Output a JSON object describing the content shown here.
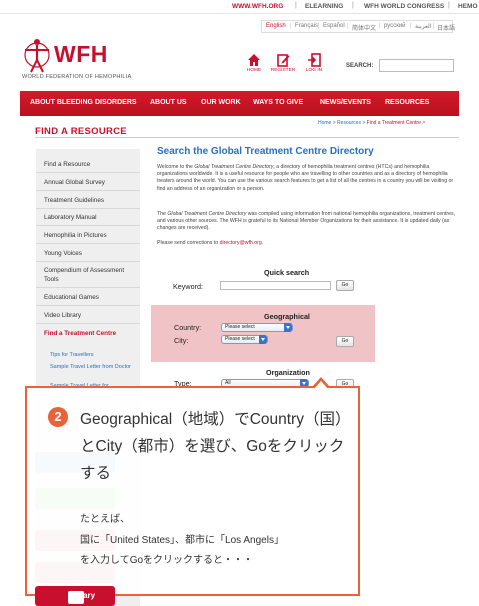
{
  "topbar": {
    "site": "WWW.WFH.ORG",
    "links": [
      "ELEARNING",
      "WFH WORLD CONGRESS",
      "HEMO"
    ],
    "separator": "|"
  },
  "languages": {
    "active": "English",
    "others": [
      "Français",
      "Español",
      "简体中文",
      "русский",
      "العربية",
      "日本語"
    ],
    "separator": "|"
  },
  "logo": {
    "text": "WFH",
    "subtitle": "WORLD FEDERATION OF HEMOPHILIA"
  },
  "header_icons": [
    {
      "label": "HOME",
      "icon": "home-icon"
    },
    {
      "label": "REGISTER",
      "icon": "register-icon"
    },
    {
      "label": "LOG IN",
      "icon": "login-icon"
    }
  ],
  "search": {
    "label": "SEARCH:",
    "value": ""
  },
  "nav": [
    "ABOUT BLEEDING DISORDERS",
    "ABOUT US",
    "OUR WORK",
    "WAYS TO GIVE",
    "NEWS/EVENTS",
    "RESOURCES"
  ],
  "page": {
    "section_title": "FIND A RESOURCE",
    "breadcrumb": [
      "Home",
      "Resources",
      "Find a Treatment Centre"
    ],
    "breadcrumb_sep": ">"
  },
  "sidebar": {
    "items": [
      "Find a Resource",
      "Annual Global Survey",
      "Treatment Guidelines",
      "Laboratory Manual",
      "Hemophilia in Pictures",
      "Young Voices",
      "Compendium of Assessment Tools",
      "Educational Games",
      "Video Library",
      "Find a Treatment Centre"
    ],
    "subitems": [
      "Tips for Travellers",
      "Sample Travel Letter from Doctor",
      "Sample Travel Letter for"
    ],
    "library_button": "Library"
  },
  "main": {
    "title": "Search the Global Treatment Centre Directory",
    "intro_pre": "Welcome to the ",
    "intro_em": "Global Treatment Centre Directory",
    "intro_post": ", a directory of hemophilia treatment centres (HTCs) and hemophilia organizations worldwide. It is a useful resource for people who are travelling to other countries and as a directory of hemophilia treaters around the world. You can use the various search features to get a list of all the centres in a country you will be visiting or find an address of an organization or a person.",
    "compiled_pre": "The ",
    "compiled_em": "Global Treatment Centre Directory",
    "compiled_post": " was compiled using information from national hemophilia organizations, treatment centres, and various other sources. The WFH is grateful to its National Member Organizations for their assistance. It is updated daily (as changes are received).",
    "corrections_pre": "Please send corrections to ",
    "corrections_email": "directory@wfh.org",
    "corrections_post": "."
  },
  "quick_search": {
    "title": "Quick search",
    "keyword_label": "Keyword:",
    "keyword_value": "",
    "go": "Go"
  },
  "geographical": {
    "title": "Geographical",
    "country_label": "Country:",
    "country_value": "Please select",
    "city_label": "City:",
    "city_value": "Please select",
    "go": "Go"
  },
  "organization": {
    "title": "Organization",
    "type_label": "Type:",
    "type_value": "All",
    "go": "Go"
  },
  "callout": {
    "step": "2",
    "heading": "Geographical（地域）でCountry（国）とCity（都市）を選び、Goをクリックする",
    "body_1": "たとえば、",
    "body_2": "国に「United States」、都市に「Los Angels」",
    "body_3": "を入力してGoをクリックすると・・・",
    "accent_color": "#e8633a"
  },
  "colors": {
    "brand_red": "#c8102e",
    "link_blue": "#2a6fbd",
    "geo_highlight": "#f0c4c6"
  }
}
